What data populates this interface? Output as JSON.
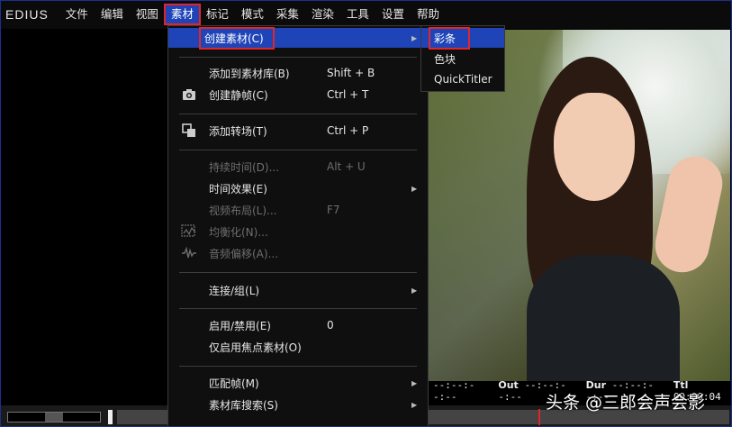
{
  "app": {
    "logo": "EDIUS"
  },
  "menubar": {
    "items": [
      "文件",
      "编辑",
      "视图",
      "素材",
      "标记",
      "模式",
      "采集",
      "渲染",
      "工具",
      "设置",
      "帮助"
    ],
    "active_index": 3
  },
  "dropdown": {
    "create_clip": "创建素材(C)",
    "add_to_bin": "添加到素材库(B)",
    "add_to_bin_shortcut": "Shift + B",
    "create_still": "创建静帧(C)",
    "create_still_shortcut": "Ctrl + T",
    "add_transition": "添加转场(T)",
    "add_transition_shortcut": "Ctrl + P",
    "duration": "持续时间(D)...",
    "duration_shortcut": "Alt + U",
    "time_effect": "时间效果(E)",
    "video_layout": "视频布局(L)...",
    "video_layout_shortcut": "F7",
    "normalize": "均衡化(N)...",
    "audio_offset": "音频偏移(A)...",
    "link_group": "连接/组(L)",
    "enable_disable": "启用/禁用(E)",
    "enable_disable_shortcut": "0",
    "enable_focus_only": "仅启用焦点素材(O)",
    "match_frame": "匹配帧(M)",
    "bin_search": "素材库搜索(S)"
  },
  "submenu": {
    "items": [
      "彩条",
      "色块",
      "QuickTitler"
    ],
    "highlight_index": 0
  },
  "timecode": {
    "in_value": "--:--:--:--",
    "out_label": "Out",
    "out_value": "--:--:--:--",
    "dur_label": "Dur",
    "dur_value": "--:--:--:--",
    "ttl_label": "Ttl",
    "ttl_value": "00:00:04"
  },
  "watermark": "头条 @三郎会声会影",
  "colors": {
    "highlight": "#1f44b8",
    "annotation_red": "#e0262b",
    "menu_bg": "#0f0f0f"
  }
}
